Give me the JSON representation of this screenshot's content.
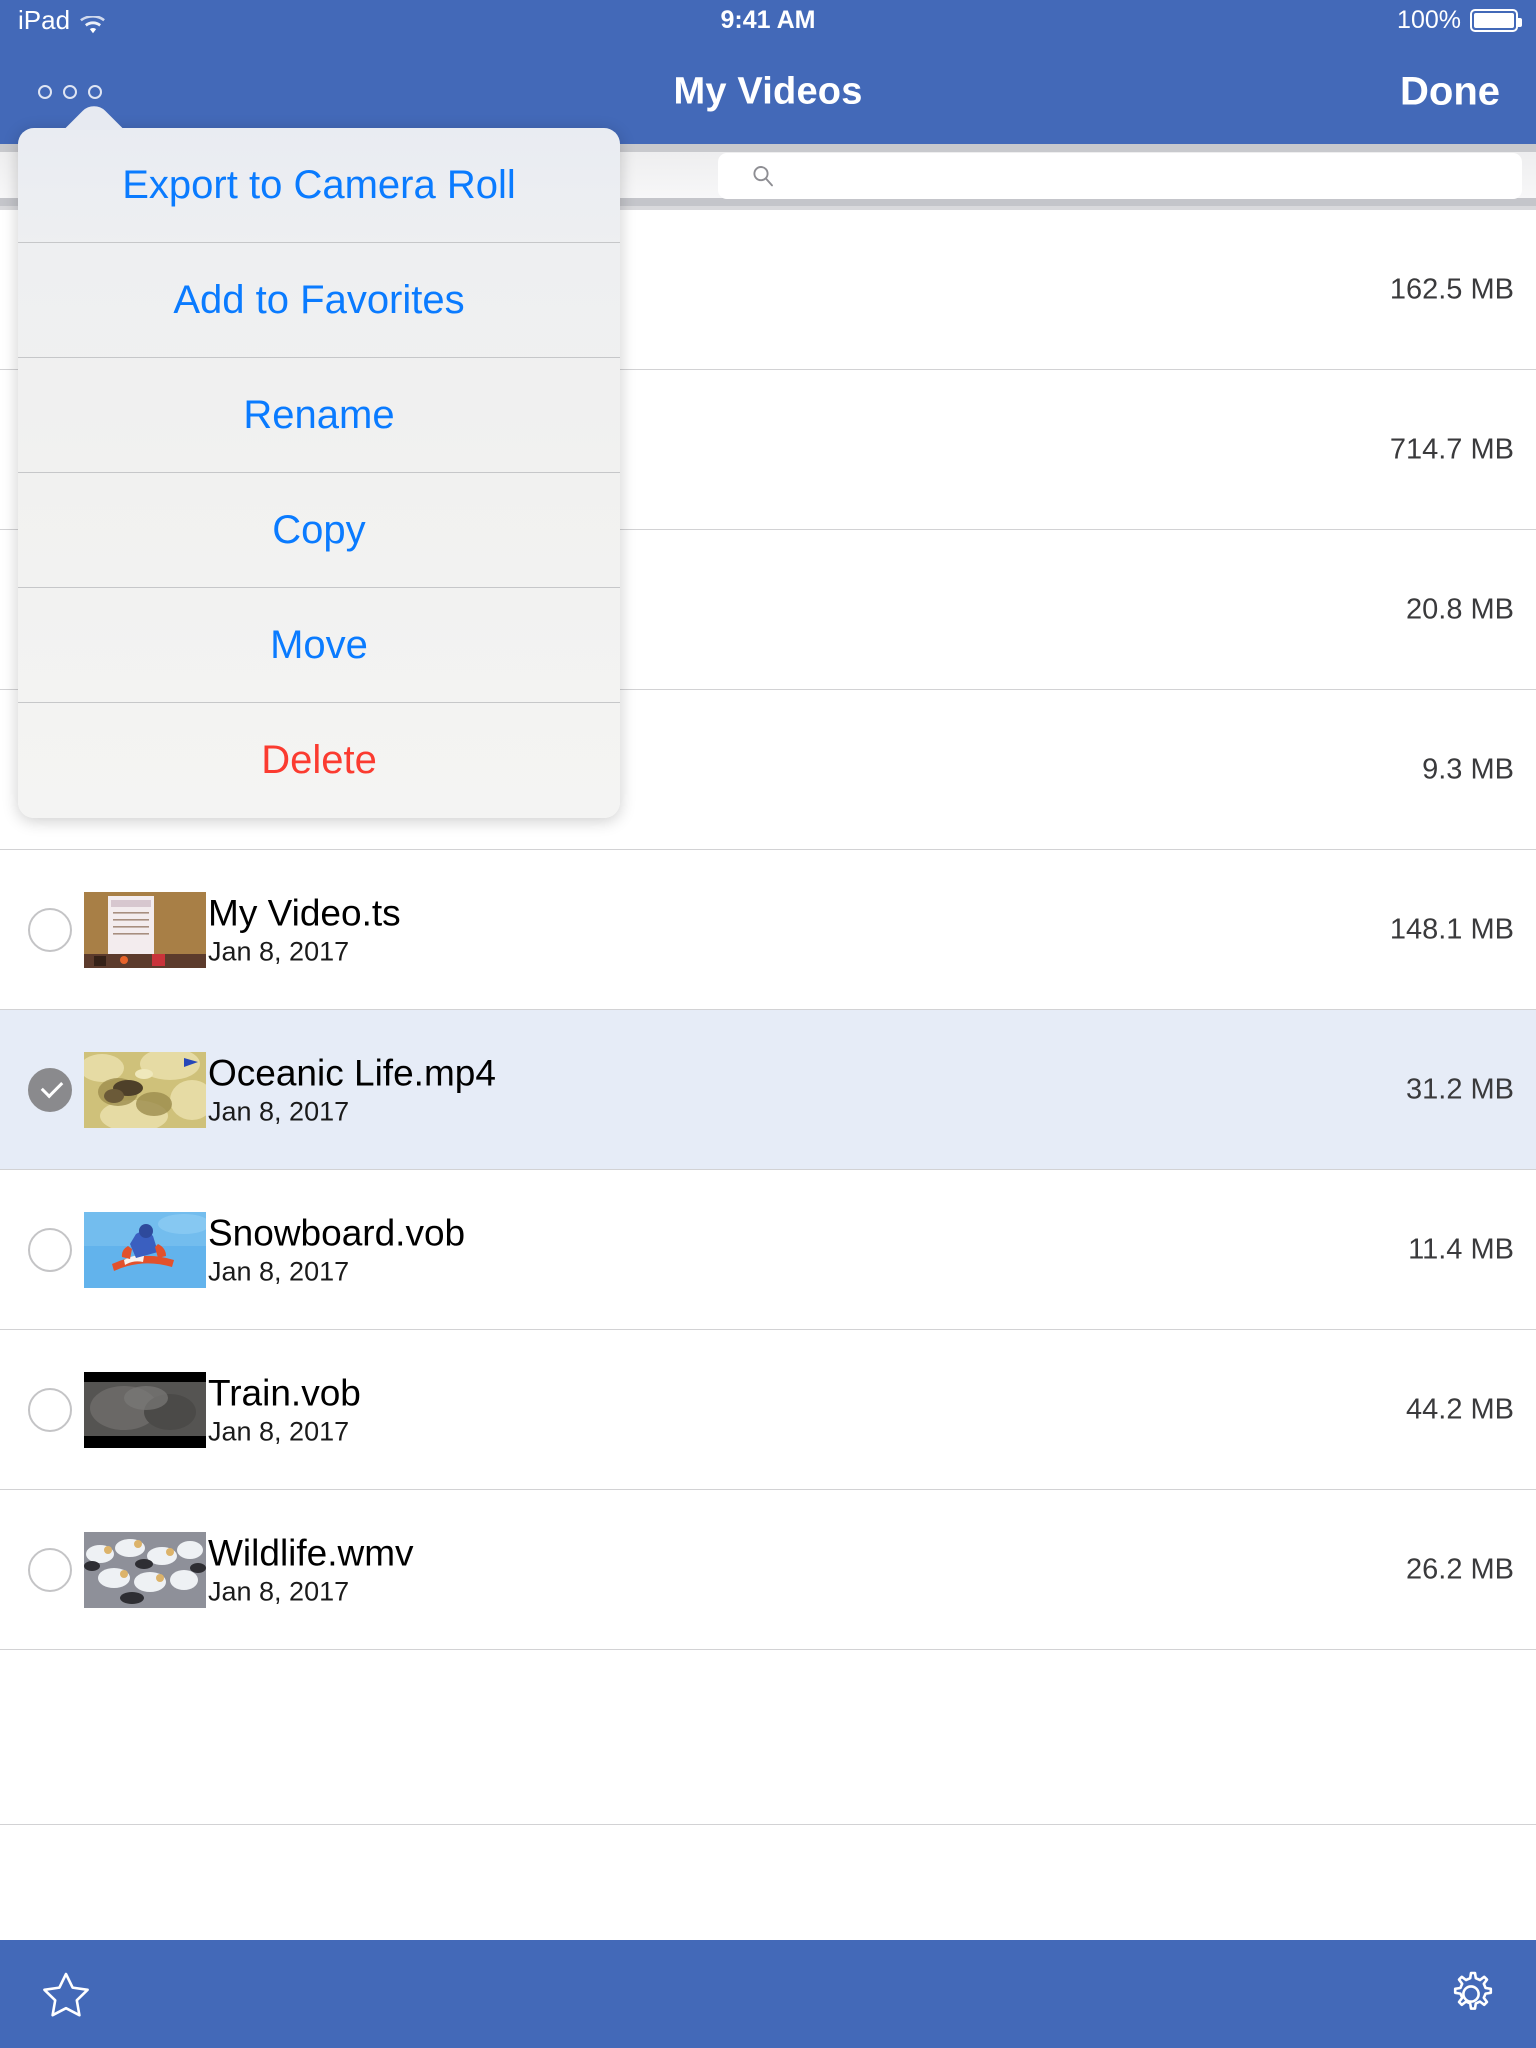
{
  "statusbar": {
    "device": "iPad",
    "wifi_icon": "wifi-icon",
    "time": "9:41 AM",
    "battery_percent": "100%",
    "battery_icon": "battery-icon"
  },
  "navbar": {
    "more_icon": "more-dots-icon",
    "title": "My Videos",
    "done_label": "Done"
  },
  "search": {
    "icon": "search-icon",
    "value": "",
    "placeholder": ""
  },
  "popover": {
    "tail_icon": "popover-tail",
    "items": [
      {
        "label": "Export to Camera Roll",
        "style": "default"
      },
      {
        "label": "Add to Favorites",
        "style": "default"
      },
      {
        "label": "Rename",
        "style": "default"
      },
      {
        "label": "Copy",
        "style": "default"
      },
      {
        "label": "Move",
        "style": "default"
      },
      {
        "label": "Delete",
        "style": "destructive"
      }
    ]
  },
  "list": {
    "hidden_rows": [
      {
        "size": "162.5 MB"
      },
      {
        "size": "714.7 MB"
      },
      {
        "size": "20.8 MB"
      },
      {
        "size": "9.3 MB"
      }
    ],
    "rows": [
      {
        "name": "My Video.ts",
        "date": "Jan 8, 2017",
        "size": "148.1 MB",
        "selected": false,
        "thumb": "calendar-photo"
      },
      {
        "name": "Oceanic Life.mp4",
        "date": "Jan 8, 2017",
        "size": "31.2 MB",
        "selected": true,
        "thumb": "reef-photo"
      },
      {
        "name": "Snowboard.vob",
        "date": "Jan 8, 2017",
        "size": "11.4 MB",
        "selected": false,
        "thumb": "snowboard-photo"
      },
      {
        "name": "Train.vob",
        "date": "Jan 8, 2017",
        "size": "44.2 MB",
        "selected": false,
        "thumb": "train-photo"
      },
      {
        "name": "Wildlife.wmv",
        "date": "Jan 8, 2017",
        "size": "26.2 MB",
        "selected": false,
        "thumb": "birds-photo"
      }
    ]
  },
  "toolbar": {
    "star_icon": "star-icon",
    "gear_icon": "gear-icon"
  },
  "colors": {
    "nav_blue": "#4369b8",
    "action_blue": "#0a7bff",
    "destructive_red": "#fb3b30",
    "selected_row": "#e6ecf7"
  }
}
